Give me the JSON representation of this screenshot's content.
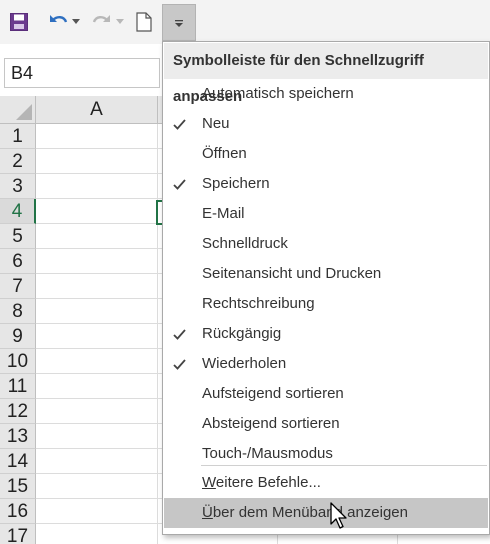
{
  "namebox": {
    "value": "B4"
  },
  "grid": {
    "columns": [
      {
        "label": "A"
      }
    ],
    "rows": [
      "1",
      "2",
      "3",
      "4",
      "5",
      "6",
      "7",
      "8",
      "9",
      "10",
      "11",
      "12",
      "13",
      "14",
      "15",
      "16",
      "17"
    ],
    "active_row": "4"
  },
  "toolbar": {
    "icons": [
      "save-icon",
      "undo-icon",
      "redo-icon",
      "new-document-icon",
      "customize-toolbar-icon"
    ]
  },
  "menu": {
    "title": "Symbolleiste für den Schnellzugriff anpassen",
    "items": [
      {
        "label": "Automatisch speichern",
        "checked": false
      },
      {
        "label": "Neu",
        "checked": true
      },
      {
        "label": "Öffnen",
        "checked": false
      },
      {
        "label": "Speichern",
        "checked": true
      },
      {
        "label": "E-Mail",
        "checked": false
      },
      {
        "label": "Schnelldruck",
        "checked": false
      },
      {
        "label": "Seitenansicht und Drucken",
        "checked": false
      },
      {
        "label": "Rechtschreibung",
        "checked": false
      },
      {
        "label": "Rückgängig",
        "checked": true
      },
      {
        "label": "Wiederholen",
        "checked": true
      },
      {
        "label": "Aufsteigend sortieren",
        "checked": false
      },
      {
        "label": "Absteigend sortieren",
        "checked": false
      },
      {
        "label": "Touch-/Mausmodus",
        "checked": false
      }
    ],
    "more_commands": "Weitere Befehle...",
    "show_below": "Über dem Menüband anzeigen"
  },
  "colors": {
    "accent": "#217346",
    "undo_blue": "#2e6fc0",
    "save_purple": "#6b3a8e",
    "highlight": "#c6c6c6"
  }
}
